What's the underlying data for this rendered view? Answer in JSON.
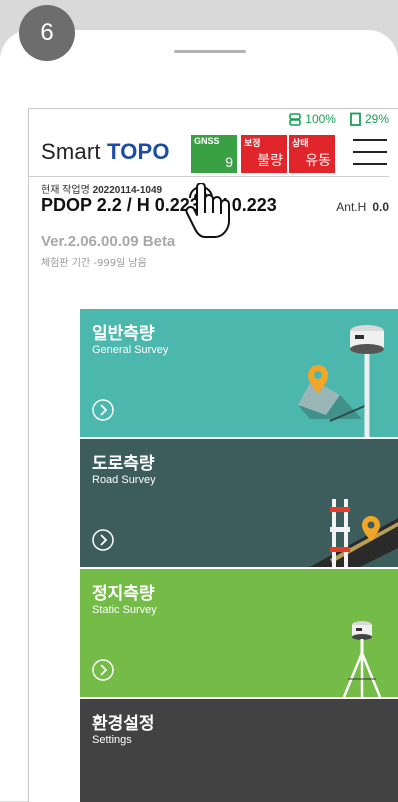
{
  "step_badge": "6",
  "status_bar": {
    "gnss_receiver": "100%",
    "battery": "29%"
  },
  "app": {
    "title_plain": "Smart",
    "title_bold": "TOPO"
  },
  "chips": [
    {
      "label": "GNSS",
      "value": "9",
      "color": "#3aa044"
    },
    {
      "label": "보정",
      "value": "불량",
      "color": "#e0252b"
    },
    {
      "label": "상태",
      "value": "유동",
      "color": "#e0252b"
    }
  ],
  "job": {
    "label": "현재 작업명",
    "name": "20220114-1049"
  },
  "precision": {
    "text": "PDOP 2.2 / H 0.223 / V 0.223",
    "ant_label": "Ant.H",
    "ant_value": "0.0"
  },
  "version": "Ver.2.06.00.09  Beta",
  "trial": "체험판 기간 -999일 남음",
  "menu_cards": [
    {
      "kor": "일반측량",
      "eng": "General Survey",
      "color": "#4bb7ad"
    },
    {
      "kor": "도로측량",
      "eng": "Road Survey",
      "color": "#3c5d5c"
    },
    {
      "kor": "정지측량",
      "eng": "Static Survey",
      "color": "#74bb48"
    },
    {
      "kor": "환경설정",
      "eng": "Settings",
      "color": "#424242"
    }
  ]
}
